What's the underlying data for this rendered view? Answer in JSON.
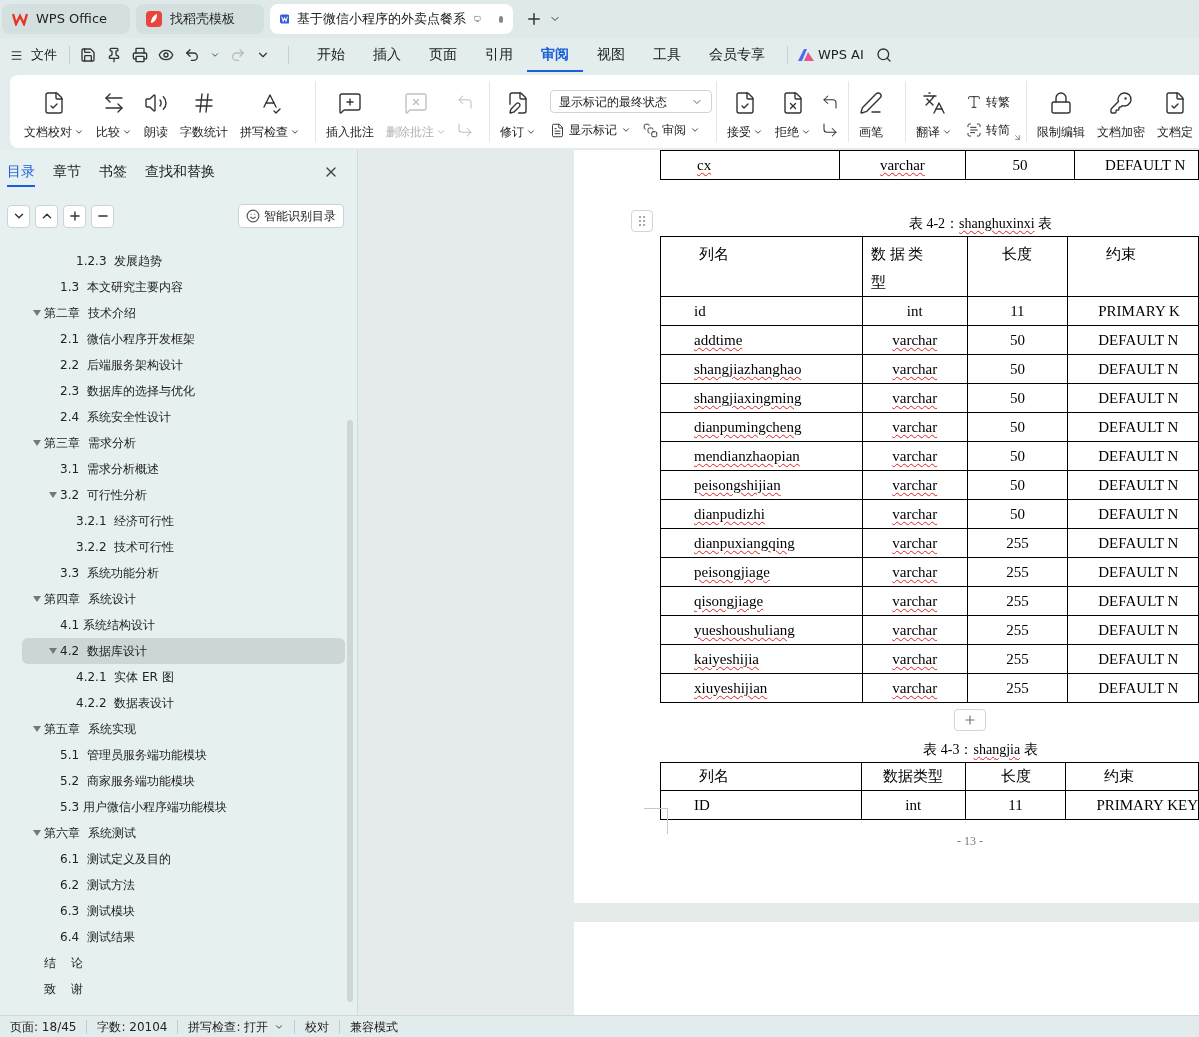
{
  "tabs": [
    {
      "kind": "wps",
      "label": "WPS Office",
      "selected": false,
      "modified": false
    },
    {
      "kind": "template",
      "label": "找稻壳模板",
      "selected": false,
      "modified": false
    },
    {
      "kind": "doc",
      "label": "基于微信小程序的外卖点餐系",
      "selected": true,
      "modified": true
    }
  ],
  "menu": {
    "file": "文件",
    "tabs": [
      {
        "label": "开始",
        "selected": false
      },
      {
        "label": "插入",
        "selected": false
      },
      {
        "label": "页面",
        "selected": false
      },
      {
        "label": "引用",
        "selected": false
      },
      {
        "label": "审阅",
        "selected": true
      },
      {
        "label": "视图",
        "selected": false
      },
      {
        "label": "工具",
        "selected": false
      },
      {
        "label": "会员专享",
        "selected": false
      }
    ],
    "ai": "WPS AI"
  },
  "ribbon": {
    "groups": [
      {
        "items": [
          {
            "kind": "large",
            "label": "文档校对",
            "dropdown": true,
            "disabled": false
          },
          {
            "kind": "large",
            "label": "比较",
            "dropdown": true,
            "disabled": false
          },
          {
            "kind": "large",
            "label": "朗读",
            "dropdown": false,
            "disabled": false
          },
          {
            "kind": "large",
            "label": "字数统计",
            "dropdown": false,
            "disabled": false
          },
          {
            "kind": "large",
            "label": "拼写检查",
            "dropdown": true,
            "disabled": false
          }
        ]
      },
      {
        "items": [
          {
            "kind": "large",
            "label": "插入批注",
            "dropdown": false,
            "disabled": false
          },
          {
            "kind": "large",
            "label": "删除批注",
            "dropdown": true,
            "disabled": true
          },
          {
            "kind": "stack",
            "disabled": true
          }
        ]
      },
      {
        "items": [
          {
            "kind": "large",
            "label": "修订",
            "dropdown": true,
            "disabled": false
          },
          {
            "kind": "select",
            "value": "显示标记的最终状态",
            "items": [
              {
                "label": "显示标记",
                "dropdown": true
              },
              {
                "label": "审阅",
                "dropdown": true
              }
            ]
          }
        ]
      },
      {
        "items": [
          {
            "kind": "large",
            "label": "接受",
            "dropdown": true,
            "disabled": false
          },
          {
            "kind": "large",
            "label": "拒绝",
            "dropdown": true,
            "disabled": false
          },
          {
            "kind": "stack",
            "disabled": false
          }
        ]
      },
      {
        "items": [
          {
            "kind": "large",
            "label": "画笔",
            "dropdown": false,
            "disabled": false
          }
        ]
      },
      {
        "items": [
          {
            "kind": "large",
            "label": "翻译",
            "dropdown": true,
            "disabled": false
          },
          {
            "kind": "pair",
            "items": [
              {
                "label": "转繁"
              },
              {
                "label": "转简"
              }
            ]
          }
        ]
      },
      {
        "items": [
          {
            "kind": "large",
            "label": "限制编辑",
            "dropdown": false,
            "disabled": false
          },
          {
            "kind": "large",
            "label": "文档加密",
            "dropdown": false,
            "disabled": false
          },
          {
            "kind": "large",
            "label": "文档定",
            "dropdown": false,
            "disabled": false
          }
        ]
      }
    ]
  },
  "sidebar": {
    "tabs": [
      {
        "label": "目录",
        "selected": true
      },
      {
        "label": "章节",
        "selected": false
      },
      {
        "label": "书签",
        "selected": false
      },
      {
        "label": "查找和替换",
        "selected": false
      }
    ],
    "smart_button": "智能识别目录",
    "toc": [
      {
        "children": [
          {
            "children": [
              {
                "label": "1.2.3  发展趋势",
                "selected": false
              }
            ]
          },
          {
            "label": "1.3  本文研究主要内容",
            "selected": false
          }
        ]
      },
      {
        "label": "第二章  技术介绍",
        "expanded": true,
        "selected": false,
        "children": [
          {
            "label": "2.1  微信小程序开发框架",
            "selected": false
          },
          {
            "label": "2.2  后端服务架构设计",
            "selected": false
          },
          {
            "label": "2.3  数据库的选择与优化",
            "selected": false
          },
          {
            "label": "2.4  系统安全性设计",
            "selected": false
          }
        ]
      },
      {
        "label": "第三章  需求分析",
        "expanded": true,
        "selected": false,
        "children": [
          {
            "label": "3.1  需求分析概述",
            "selected": false
          },
          {
            "label": "3.2  可行性分析",
            "expanded": true,
            "selected": false,
            "children": [
              {
                "label": "3.2.1  经济可行性",
                "selected": false
              },
              {
                "label": "3.2.2  技术可行性",
                "selected": false
              }
            ]
          },
          {
            "label": "3.3  系统功能分析",
            "selected": false
          }
        ]
      },
      {
        "label": "第四章  系统设计",
        "expanded": true,
        "selected": false,
        "children": [
          {
            "label": "4.1 系统结构设计",
            "selected": false
          },
          {
            "label": "4.2  数据库设计",
            "expanded": true,
            "selected": true,
            "children": [
              {
                "label": "4.2.1  实体 ER 图",
                "selected": false
              },
              {
                "label": "4.2.2  数据表设计",
                "selected": false
              }
            ]
          }
        ]
      },
      {
        "label": "第五章  系统实现",
        "expanded": true,
        "selected": false,
        "children": [
          {
            "label": "5.1  管理员服务端功能模块",
            "selected": false
          },
          {
            "label": "5.2  商家服务端功能模块",
            "selected": false
          },
          {
            "label": "5.3 用户微信小程序端功能模块",
            "selected": false
          }
        ]
      },
      {
        "label": "第六章  系统测试",
        "expanded": true,
        "selected": false,
        "children": [
          {
            "label": "6.1  测试定义及目的",
            "selected": false
          },
          {
            "label": "6.2  测试方法",
            "selected": false
          },
          {
            "label": "6.3  测试模块",
            "selected": false
          },
          {
            "label": "6.4  测试结果",
            "selected": false
          }
        ]
      },
      {
        "label": "结    论",
        "selected": false
      },
      {
        "label": "致    谢",
        "selected": false
      }
    ]
  },
  "document": {
    "tables": [
      {
        "rows": [
          [
            {
              "text": "cx",
              "misspelled": true
            },
            {
              "text": "varchar",
              "misspelled": true
            },
            {
              "text": "50",
              "misspelled": false
            },
            {
              "text": "DEFAULT N",
              "misspelled": false
            }
          ]
        ]
      },
      {
        "caption": [
          {
            "text": "表 4-2：",
            "misspelled": false
          },
          {
            "text": "shanghuxinxi",
            "misspelled": true
          },
          {
            "text": " 表",
            "misspelled": false
          }
        ],
        "header": [
          "列名",
          "数据类型",
          "长度",
          "约束"
        ],
        "rows": [
          [
            {
              "text": "id",
              "misspelled": false
            },
            {
              "text": "int",
              "misspelled": false
            },
            {
              "text": "11",
              "misspelled": false
            },
            {
              "text": "PRIMARY K",
              "misspelled": false
            }
          ],
          [
            {
              "text": "addtime",
              "misspelled": true
            },
            {
              "text": "varchar",
              "misspelled": true
            },
            {
              "text": "50",
              "misspelled": false
            },
            {
              "text": "DEFAULT N",
              "misspelled": false
            }
          ],
          [
            {
              "text": "shangjiazhanghao",
              "misspelled": true
            },
            {
              "text": "varchar",
              "misspelled": true
            },
            {
              "text": "50",
              "misspelled": false
            },
            {
              "text": "DEFAULT N",
              "misspelled": false
            }
          ],
          [
            {
              "text": "shangjiaxingming",
              "misspelled": true
            },
            {
              "text": "varchar",
              "misspelled": true
            },
            {
              "text": "50",
              "misspelled": false
            },
            {
              "text": "DEFAULT N",
              "misspelled": false
            }
          ],
          [
            {
              "text": "dianpumingcheng",
              "misspelled": true
            },
            {
              "text": "varchar",
              "misspelled": true
            },
            {
              "text": "50",
              "misspelled": false
            },
            {
              "text": "DEFAULT N",
              "misspelled": false
            }
          ],
          [
            {
              "text": "mendianzhaopian",
              "misspelled": true
            },
            {
              "text": "varchar",
              "misspelled": true
            },
            {
              "text": "50",
              "misspelled": false
            },
            {
              "text": "DEFAULT N",
              "misspelled": false
            }
          ],
          [
            {
              "text": "peisongshijian",
              "misspelled": true
            },
            {
              "text": "varchar",
              "misspelled": true
            },
            {
              "text": "50",
              "misspelled": false
            },
            {
              "text": "DEFAULT N",
              "misspelled": false
            }
          ],
          [
            {
              "text": "dianpudizhi",
              "misspelled": true
            },
            {
              "text": "varchar",
              "misspelled": true
            },
            {
              "text": "50",
              "misspelled": false
            },
            {
              "text": "DEFAULT N",
              "misspelled": false
            }
          ],
          [
            {
              "text": "dianpuxiangqing",
              "misspelled": true
            },
            {
              "text": "varchar",
              "misspelled": true
            },
            {
              "text": "255",
              "misspelled": false
            },
            {
              "text": "DEFAULT N",
              "misspelled": false
            }
          ],
          [
            {
              "text": "peisongjiage",
              "misspelled": true
            },
            {
              "text": "varchar",
              "misspelled": true
            },
            {
              "text": "255",
              "misspelled": false
            },
            {
              "text": "DEFAULT N",
              "misspelled": false
            }
          ],
          [
            {
              "text": "qisongjiage",
              "misspelled": true
            },
            {
              "text": "varchar",
              "misspelled": true
            },
            {
              "text": "255",
              "misspelled": false
            },
            {
              "text": "DEFAULT N",
              "misspelled": false
            }
          ],
          [
            {
              "text": "yueshoushuliang",
              "misspelled": true
            },
            {
              "text": "varchar",
              "misspelled": true
            },
            {
              "text": "255",
              "misspelled": false
            },
            {
              "text": "DEFAULT N",
              "misspelled": false
            }
          ],
          [
            {
              "text": "kaiyeshijia",
              "misspelled": true
            },
            {
              "text": "varchar",
              "misspelled": true
            },
            {
              "text": "255",
              "misspelled": false
            },
            {
              "text": "DEFAULT N",
              "misspelled": false
            }
          ],
          [
            {
              "text": "xiuyeshijian",
              "misspelled": true
            },
            {
              "text": "varchar",
              "misspelled": true
            },
            {
              "text": "255",
              "misspelled": false
            },
            {
              "text": "DEFAULT N",
              "misspelled": false
            }
          ]
        ]
      },
      {
        "caption": [
          {
            "text": "表 4-3：",
            "misspelled": false
          },
          {
            "text": "shangjia",
            "misspelled": true
          },
          {
            "text": " 表",
            "misspelled": false
          }
        ],
        "header": [
          "列名",
          "数据类型",
          "长度",
          "约束"
        ],
        "rows": [
          [
            {
              "text": "ID",
              "misspelled": false
            },
            {
              "text": "int",
              "misspelled": false
            },
            {
              "text": "11",
              "misspelled": false
            },
            {
              "text": "PRIMARY KEY",
              "misspelled": false
            }
          ]
        ]
      }
    ],
    "page_number": "- 13 -"
  },
  "status_bar": [
    {
      "label": "页面: 18/45",
      "dropdown": false
    },
    {
      "label": "字数: 20104",
      "dropdown": false
    },
    {
      "label": "拼写检查: 打开",
      "dropdown": true
    },
    {
      "label": "校对",
      "dropdown": false
    },
    {
      "label": "兼容模式",
      "dropdown": false
    }
  ]
}
